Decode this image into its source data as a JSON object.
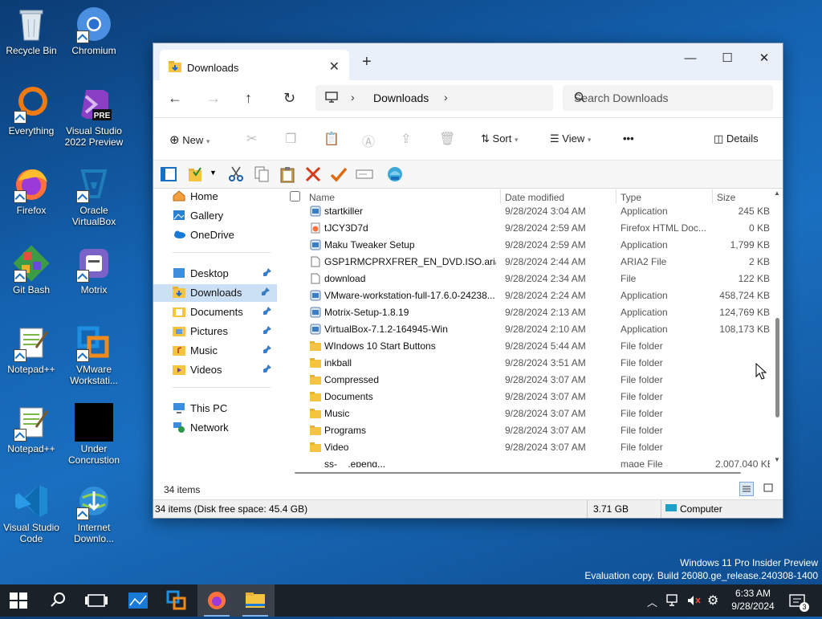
{
  "desktop": {
    "icons": [
      {
        "label": "Recycle Bin"
      },
      {
        "label": "Chromium"
      },
      {
        "label": "Everything"
      },
      {
        "label": "Visual Studio 2022 Preview"
      },
      {
        "label": "Firefox"
      },
      {
        "label": "Oracle VirtualBox"
      },
      {
        "label": "Git Bash"
      },
      {
        "label": "Motrix"
      },
      {
        "label": "Notepad++"
      },
      {
        "label": "VMware Workstati..."
      },
      {
        "label": "Notepad++"
      },
      {
        "label": "Under Concrustion"
      },
      {
        "label": "Visual Studio Code"
      },
      {
        "label": "Internet Downlo..."
      }
    ],
    "watermark_line1": "Windows 11 Pro Insider Preview",
    "watermark_line2": "Evaluation copy. Build 26080.ge_release.240308-1400"
  },
  "window": {
    "tab_title": "Downloads",
    "close_glyph": "✕",
    "newtab_glyph": "+",
    "minimize_glyph": "—",
    "maximize_glyph": "☐",
    "winclose_glyph": "✕",
    "breadcrumb": "Downloads",
    "search_placeholder": "Search Downloads",
    "cmd": {
      "new": "New",
      "sort": "Sort",
      "view": "View",
      "more": "•••",
      "details": "Details"
    }
  },
  "sidebar": {
    "items": [
      {
        "label": "Home"
      },
      {
        "label": "Gallery"
      },
      {
        "label": "OneDrive"
      },
      {
        "label": "Desktop"
      },
      {
        "label": "Downloads"
      },
      {
        "label": "Documents"
      },
      {
        "label": "Pictures"
      },
      {
        "label": "Music"
      },
      {
        "label": "Videos"
      },
      {
        "label": "This PC"
      },
      {
        "label": "Network"
      }
    ]
  },
  "list": {
    "headers": {
      "name": "Name",
      "date": "Date modified",
      "type": "Type",
      "size": "Size"
    },
    "rows": [
      {
        "name": "startkiller",
        "date": "9/28/2024 3:04 AM",
        "type": "Application",
        "size": "245 KB",
        "icon": "app"
      },
      {
        "name": "tJCY3D7d",
        "date": "9/28/2024 2:59 AM",
        "type": "Firefox HTML Doc...",
        "size": "0 KB",
        "icon": "html"
      },
      {
        "name": "Maku Tweaker Setup",
        "date": "9/28/2024 2:59 AM",
        "type": "Application",
        "size": "1,799 KB",
        "icon": "app"
      },
      {
        "name": "GSP1RMCPRXFRER_EN_DVD.ISO.aria2",
        "date": "9/28/2024 2:44 AM",
        "type": "ARIA2 File",
        "size": "2 KB",
        "icon": "file"
      },
      {
        "name": "download",
        "date": "9/28/2024 2:34 AM",
        "type": "File",
        "size": "122 KB",
        "icon": "file"
      },
      {
        "name": "VMware-workstation-full-17.6.0-24238...",
        "date": "9/28/2024 2:24 AM",
        "type": "Application",
        "size": "458,724 KB",
        "icon": "app"
      },
      {
        "name": "Motrix-Setup-1.8.19",
        "date": "9/28/2024 2:13 AM",
        "type": "Application",
        "size": "124,769 KB",
        "icon": "app"
      },
      {
        "name": "VirtualBox-7.1.2-164945-Win",
        "date": "9/28/2024 2:10 AM",
        "type": "Application",
        "size": "108,173 KB",
        "icon": "app"
      },
      {
        "name": "WIndows 10 Start Buttons",
        "date": "9/28/2024 5:44 AM",
        "type": "File folder",
        "size": "",
        "icon": "folder"
      },
      {
        "name": "inkball",
        "date": "9/28/2024 3:51 AM",
        "type": "File folder",
        "size": "",
        "icon": "folder"
      },
      {
        "name": "Compressed",
        "date": "9/28/2024 3:07 AM",
        "type": "File folder",
        "size": "",
        "icon": "folder"
      },
      {
        "name": "Documents",
        "date": "9/28/2024 3:07 AM",
        "type": "File folder",
        "size": "",
        "icon": "folder"
      },
      {
        "name": "Music",
        "date": "9/28/2024 3:07 AM",
        "type": "File folder",
        "size": "",
        "icon": "folder"
      },
      {
        "name": "Programs",
        "date": "9/28/2024 3:07 AM",
        "type": "File folder",
        "size": "",
        "icon": "folder"
      },
      {
        "name": "Video",
        "date": "9/28/2024 3:07 AM",
        "type": "File folder",
        "size": "",
        "icon": "folder"
      },
      {
        "name": "ss-                    _           .epeng...",
        "date": "",
        "type": "mage File",
        "size": "2,007,040 KB",
        "icon": "none"
      }
    ]
  },
  "status": {
    "count": "34 items",
    "disk": "34 items (Disk free space: 45.4 GB)",
    "size": "3.71 GB",
    "location": "Computer"
  },
  "taskbar": {
    "time": "6:33 AM",
    "date": "9/28/2024",
    "notif_count": "3"
  }
}
